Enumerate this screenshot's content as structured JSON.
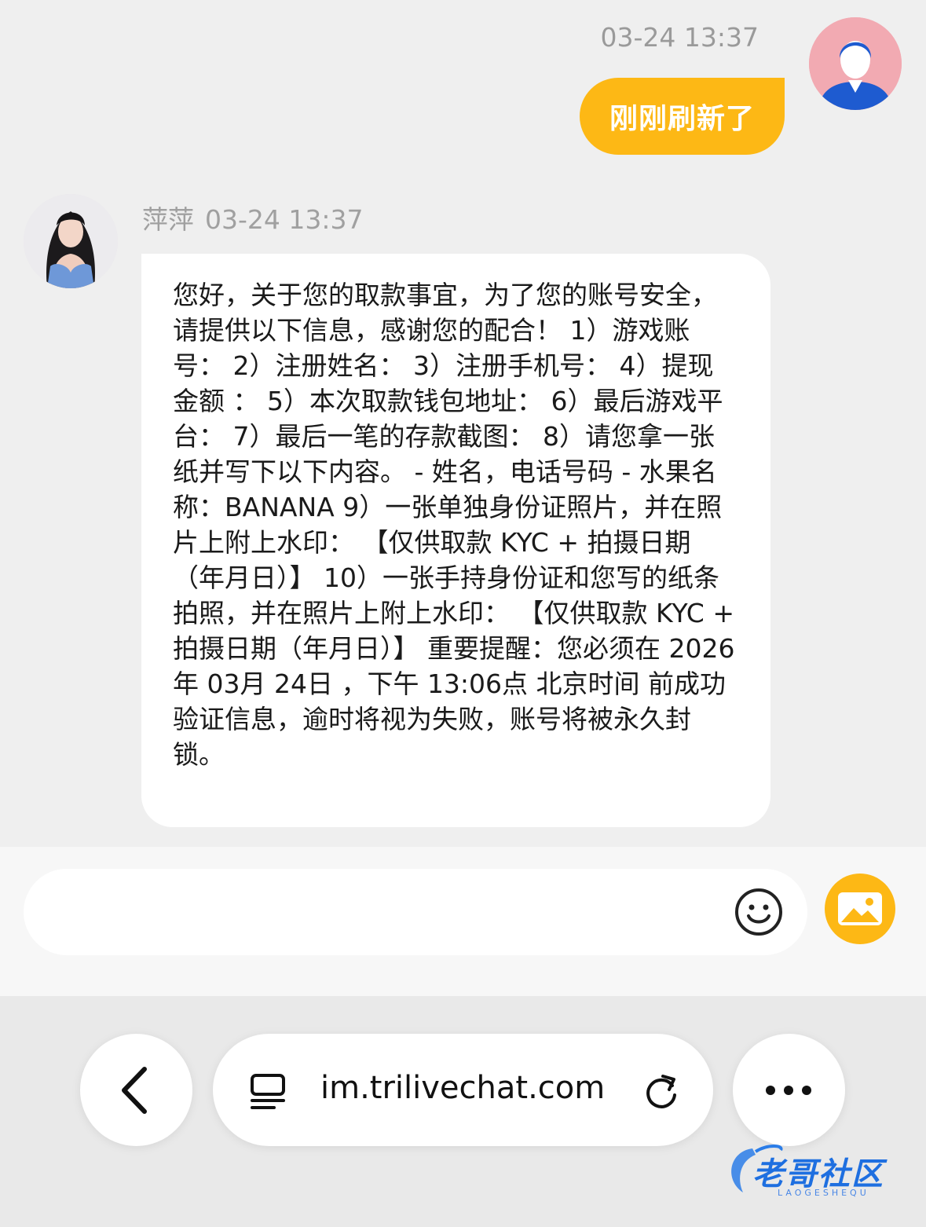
{
  "chat": {
    "user_message": {
      "timestamp": "03-24 13:37",
      "text": "刚刚刷新了"
    },
    "agent_message": {
      "name": "萍萍",
      "timestamp": "03-24 13:37",
      "text": "您好，关于您的取款事宜，为了您的账号安全，请提供以下信息，感谢您的配合！ 1）游戏账号： 2）注册姓名： 3）注册手机号： 4）提现金额 ： 5）本次取款钱包地址： 6）最后游戏平台： 7）最后一笔的存款截图： 8）请您拿一张纸并写下以下内容。 - 姓名，电话号码 - 水果名称：BANANA 9）一张单独身份证照片，并在照片上附上水印： 【仅供取款 KYC + 拍摄日期（年月日）】 10）一张手持身份证和您写的纸条 拍照，并在照片上附上水印： 【仅供取款 KYC + 拍摄日期（年月日）】 重要提醒：您必须在 2026年 03月 24日 ，下午 13:06点 北京时间 前成功验证信息，逾时将视为失败，账号将被永久封锁。"
    }
  },
  "input_bar": {
    "placeholder": "",
    "emoji_icon": "smiley-icon",
    "image_icon": "image-icon"
  },
  "browser": {
    "url": "im.trilivechat.com",
    "icons": [
      "chevron-left-icon",
      "reader-icon",
      "reload-icon",
      "more-icon"
    ]
  },
  "watermark": {
    "text": "老哥社区",
    "sub": "LAOGESHEQU"
  },
  "colors": {
    "accent": "#fdb815",
    "background": "#efefef",
    "bubble": "#ffffff"
  }
}
